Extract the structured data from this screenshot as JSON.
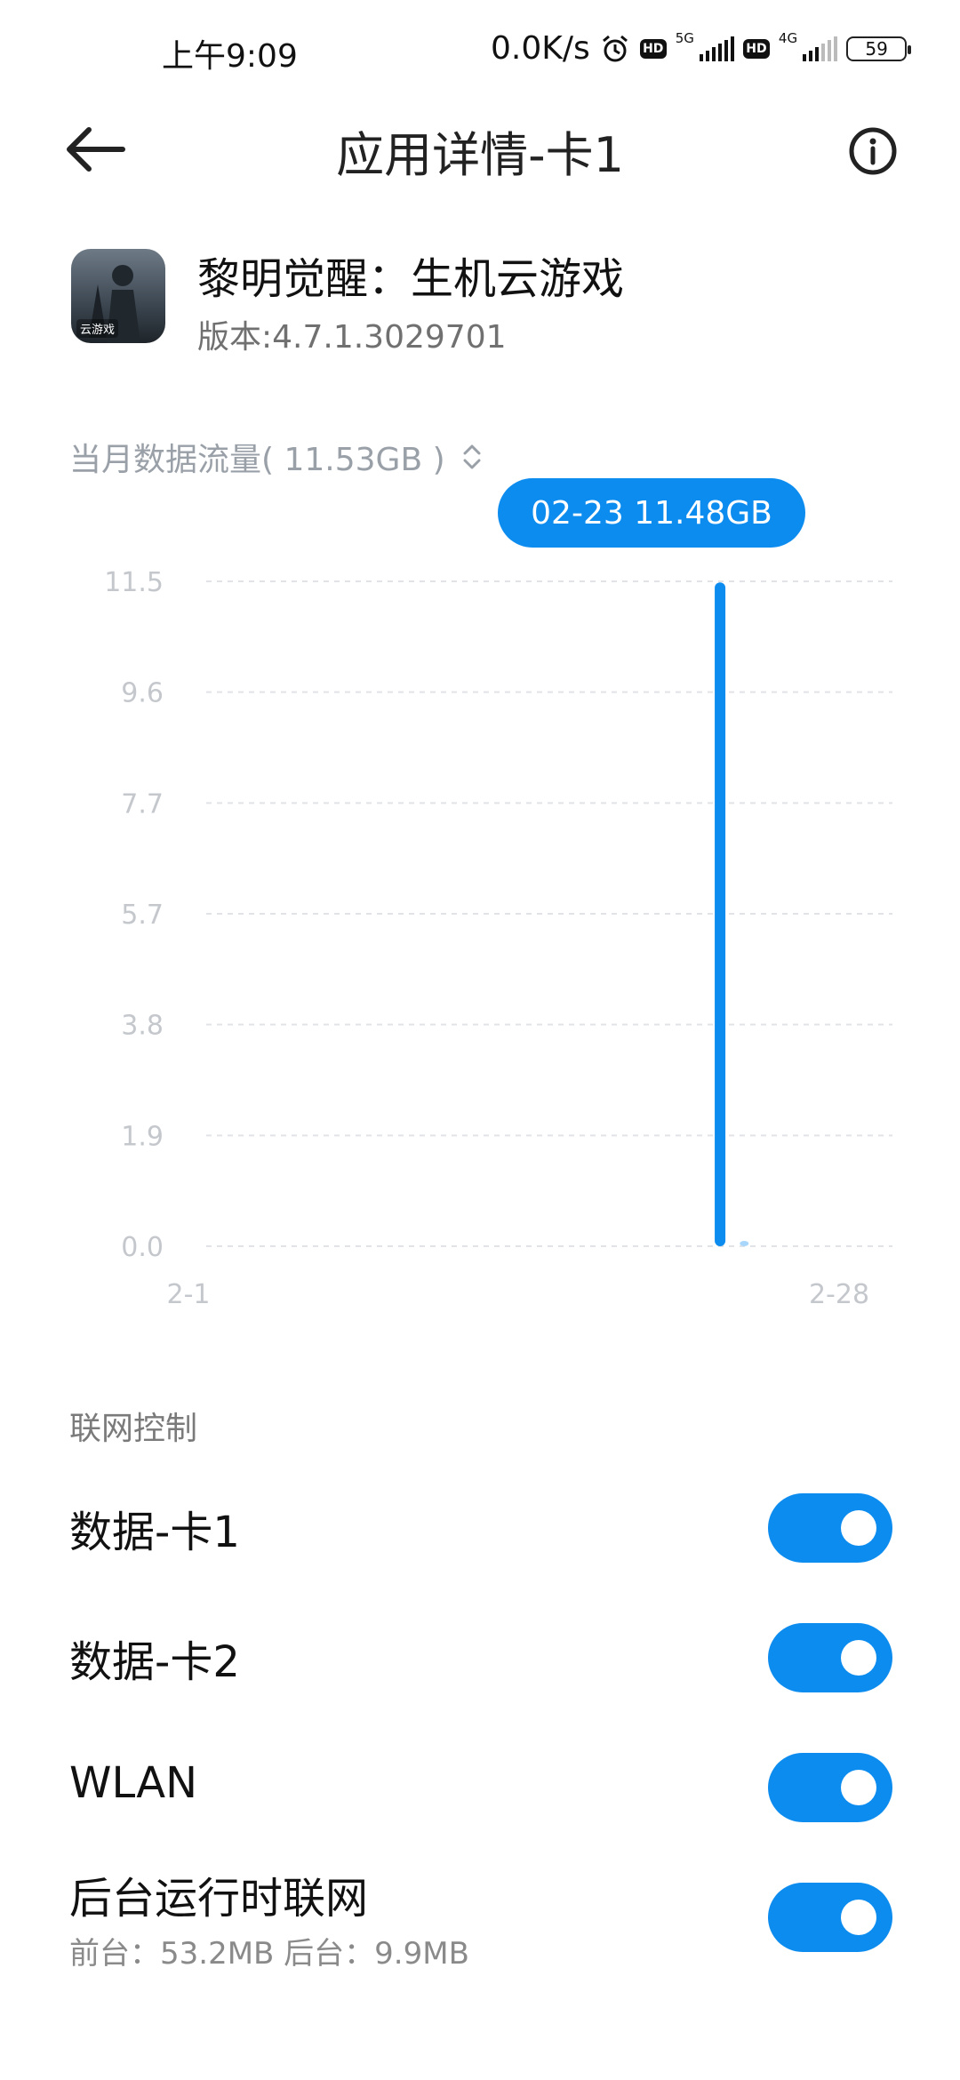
{
  "status_bar": {
    "time": "上午9:09",
    "speed": "0.0K/s",
    "hd_badge": "HD",
    "sim1_network": "5G",
    "sim2_network": "4G",
    "battery": "59",
    "icons": [
      "alarm-icon",
      "signal-icon",
      "battery-icon"
    ]
  },
  "header": {
    "title": "应用详情-卡1",
    "back_icon": "arrow-left-icon",
    "info_icon": "info-icon"
  },
  "app": {
    "name": "黎明觉醒：生机云游戏",
    "version": "版本:4.7.1.3029701",
    "icon_tag": "云游戏"
  },
  "usage": {
    "monthly_label": "当月数据流量( 11.53GB )",
    "tooltip": "02-23 11.48GB",
    "accent_color": "#0d8cf0"
  },
  "chart_data": {
    "type": "bar",
    "x_start_label": "2-1",
    "x_end_label": "2-28",
    "y_ticks": [
      "11.5",
      "9.6",
      "7.7",
      "5.7",
      "3.8",
      "1.9",
      "0.0"
    ],
    "ylim": [
      0,
      11.5
    ],
    "grid": true,
    "days": 28,
    "series": [
      {
        "values": [
          0,
          0,
          0,
          0,
          0,
          0,
          0,
          0,
          0,
          0,
          0,
          0,
          0,
          0,
          0,
          0,
          0,
          0,
          0,
          0,
          0,
          0,
          11.48,
          0.05,
          0,
          0,
          0,
          0
        ]
      }
    ]
  },
  "network_control": {
    "section_label": "联网控制",
    "items": [
      {
        "label": "数据-卡1",
        "on": true
      },
      {
        "label": "数据-卡2",
        "on": true
      },
      {
        "label": "WLAN",
        "on": true
      },
      {
        "label": "后台运行时联网",
        "sub": "前台：53.2MB  后台：9.9MB",
        "on": true
      }
    ]
  }
}
